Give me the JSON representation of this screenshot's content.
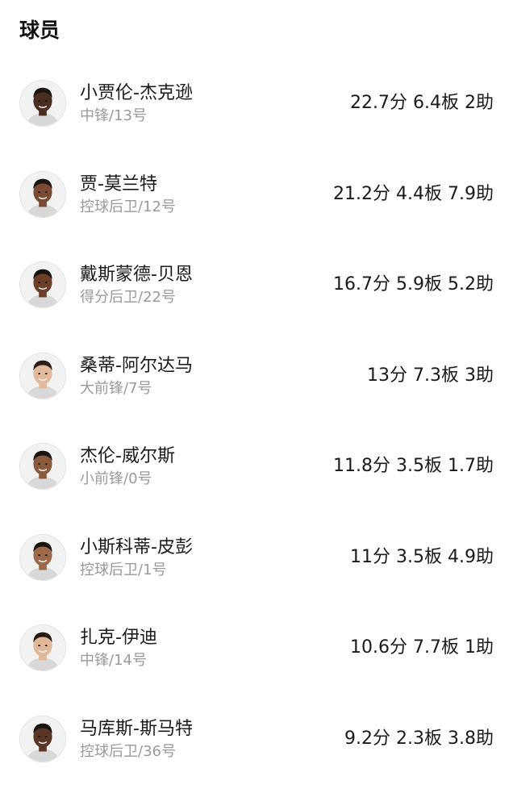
{
  "section_title": "球员",
  "players": [
    {
      "name": "小贾伦-杰克逊",
      "meta": "中锋/13号",
      "stats": "22.7分 6.4板 2助",
      "skin": "#4a2e22",
      "hair": "#1b1410"
    },
    {
      "name": "贾-莫兰特",
      "meta": "控球后卫/12号",
      "stats": "21.2分 4.4板 7.9助",
      "skin": "#7a4a32",
      "hair": "#1a1511"
    },
    {
      "name": "戴斯蒙德-贝恩",
      "meta": "得分后卫/22号",
      "stats": "16.7分 5.9板 5.2助",
      "skin": "#6b3f2a",
      "hair": "#1a1410"
    },
    {
      "name": "桑蒂-阿尔达马",
      "meta": "大前锋/7号",
      "stats": "13分 7.3板 3助",
      "skin": "#e2b99a",
      "hair": "#2a1e16"
    },
    {
      "name": "杰伦-威尔斯",
      "meta": "小前锋/0号",
      "stats": "11.8分 3.5板 1.7助",
      "skin": "#8a5a3c",
      "hair": "#1a1410"
    },
    {
      "name": "小斯科蒂-皮彭",
      "meta": "控球后卫/1号",
      "stats": "11分 3.5板 4.9助",
      "skin": "#9a6a4a",
      "hair": "#1a1410"
    },
    {
      "name": "扎克-伊迪",
      "meta": "中锋/14号",
      "stats": "10.6分 7.7板 1助",
      "skin": "#e0b898",
      "hair": "#241a14"
    },
    {
      "name": "马库斯-斯马特",
      "meta": "控球后卫/36号",
      "stats": "9.2分 2.3板 3.8助",
      "skin": "#5a3626",
      "hair": "#1a1410"
    }
  ]
}
